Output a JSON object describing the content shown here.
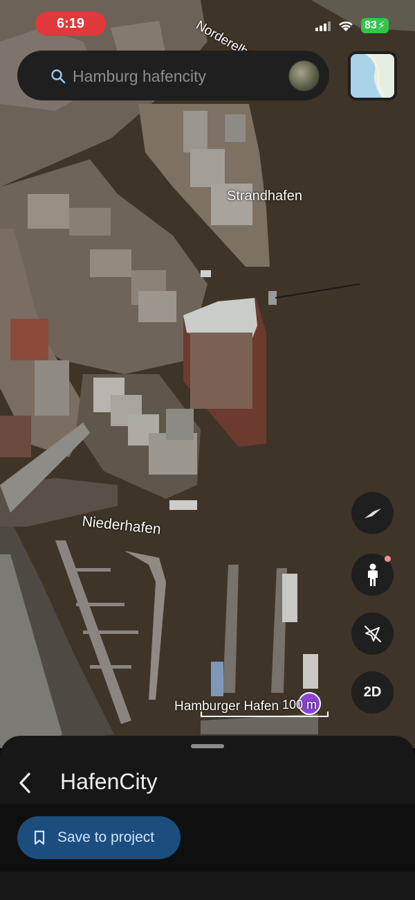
{
  "status_bar": {
    "time": "6:19",
    "battery": "83",
    "icons": [
      "signal-icon",
      "wifi-icon",
      "battery-charging-icon"
    ]
  },
  "search": {
    "text": "Hamburg hafencity",
    "icon": "search-icon"
  },
  "map": {
    "labels": {
      "norderelbe": "Norderelbe",
      "strandhafen": "Strandhafen",
      "niederhafen": "Niederhafen",
      "hamburger_hafen": "Hamburger Hafen"
    },
    "scale": "100 m"
  },
  "controls": {
    "view_mode": "2D",
    "icons": [
      "compass-icon",
      "pegman-icon",
      "location-off-icon",
      "layers-icon"
    ]
  },
  "sheet": {
    "title": "HafenCity",
    "save_button": "Save to project"
  },
  "colors": {
    "status_time_bg": "#e0383b",
    "battery": "#33c548",
    "save_button_bg": "#1b4e7e",
    "sheet_bg": "#171717",
    "water": "#3d3227"
  }
}
